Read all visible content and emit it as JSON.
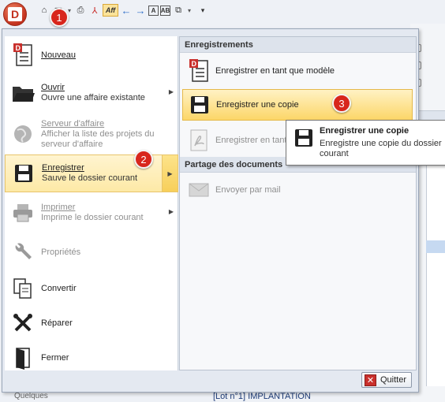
{
  "qat": {
    "app_button_letter": "D",
    "aff_label": "Aff",
    "box_a_label": "A",
    "box_ab_label": "AB"
  },
  "badges": {
    "b1": "1",
    "b2": "2",
    "b3": "3"
  },
  "left_menu": {
    "nouveau": {
      "title": "Nouveau"
    },
    "ouvrir": {
      "title": "Ouvrir",
      "desc": "Ouvre une affaire existante"
    },
    "serveur": {
      "title": "Serveur d'affaire",
      "desc1": "Afficher la liste des projets du",
      "desc2": "serveur d'affaire"
    },
    "enregistrer": {
      "title": "Enregistrer",
      "desc": "Sauve le dossier courant"
    },
    "imprimer": {
      "title": "Imprimer",
      "desc": "Imprime le dossier courant"
    },
    "proprietes": {
      "title": "Propriétés"
    },
    "convertir": {
      "title": "Convertir"
    },
    "reparer": {
      "title": "Réparer"
    },
    "fermer": {
      "title": "Fermer"
    }
  },
  "right_panel": {
    "section1": "Enregistrements",
    "modele": "Enregistrer en tant que modèle",
    "copie": "Enregistrer une copie",
    "en_tant": "Enregistrer en tant",
    "section2": "Partage des documents",
    "mail": "Envoyer par mail"
  },
  "tooltip": {
    "title": "Enregistrer une copie",
    "desc": "Enregistre une copie du dossier courant"
  },
  "footer": {
    "quit_label": "Quitter"
  },
  "background": {
    "bottom_text": "[Lot n°1] IMPLANTATION",
    "left_bottom": "Quelques"
  },
  "colors": {
    "accent_highlight": "#fcd668",
    "badge_red": "#d8261c",
    "menu_bg": "#e4e9f1"
  }
}
